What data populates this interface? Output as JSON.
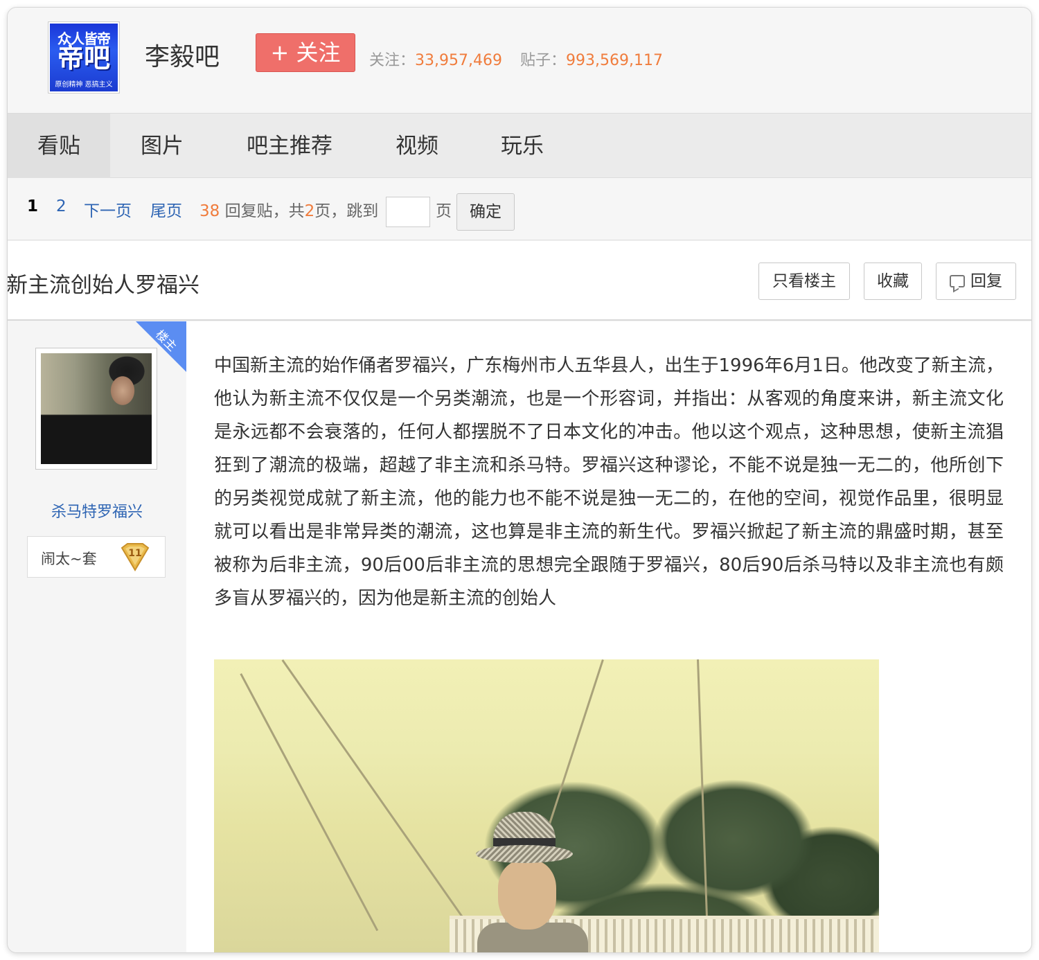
{
  "header": {
    "logo_top": "众人皆帝",
    "logo_mid": "帝吧",
    "logo_bottom": "原创精神 恶搞主义",
    "forum_name": "李毅吧",
    "follow_label": "+ 关注",
    "followers_label": "关注：",
    "followers_value": "33,957,469",
    "posts_label": "贴子：",
    "posts_value": "993,569,117"
  },
  "nav": {
    "tabs": [
      {
        "label": "看贴"
      },
      {
        "label": "图片"
      },
      {
        "label": "吧主推荐"
      },
      {
        "label": "视频"
      },
      {
        "label": "玩乐"
      }
    ]
  },
  "pager": {
    "current_page": "1",
    "page_2": "2",
    "next_page": "下一页",
    "last_page": "尾页",
    "reply_count": "38",
    "reply_text": "回复贴，共",
    "total_pages": "2",
    "page_suffix": "页，跳到",
    "page_unit": "页",
    "confirm": "确定"
  },
  "post": {
    "title": "新主流创始人罗福兴",
    "only_op": "只看楼主",
    "favorite": "收藏",
    "reply": "回复",
    "op_ribbon": "楼主",
    "author": "杀马特罗福兴",
    "badge_title": "闹太~套",
    "badge_level": "11",
    "body": "中国新主流的始作俑者罗福兴，广东梅州市人五华县人，出生于1996年6月1日。他改变了新主流，他认为新主流不仅仅是一个另类潮流，也是一个形容词，并指出：从客观的角度来讲，新主流文化是永远都不会衰落的，任何人都摆脱不了日本文化的冲击。他以这个观点，这种思想，使新主流猖狂到了潮流的极端，超越了非主流和杀马特。罗福兴这种谬论，不能不说是独一无二的，他所创下的另类视觉成就了新主流，他的能力也不能不说是独一无二的，在他的空间，视觉作品里，很明显就可以看出是非常异类的潮流，这也算是非主流的新生代。罗福兴掀起了新主流的鼎盛时期，甚至被称为后非主流，90后00后非主流的思想完全跟随于罗福兴，80后90后杀马特以及非主流也有颇多盲从罗福兴的，因为他是新主流的创始人"
  },
  "colors": {
    "link": "#2d64b3",
    "accent_orange": "#f07c3c",
    "follow_button": "#ef6f6a",
    "ribbon": "#5b8df2"
  }
}
